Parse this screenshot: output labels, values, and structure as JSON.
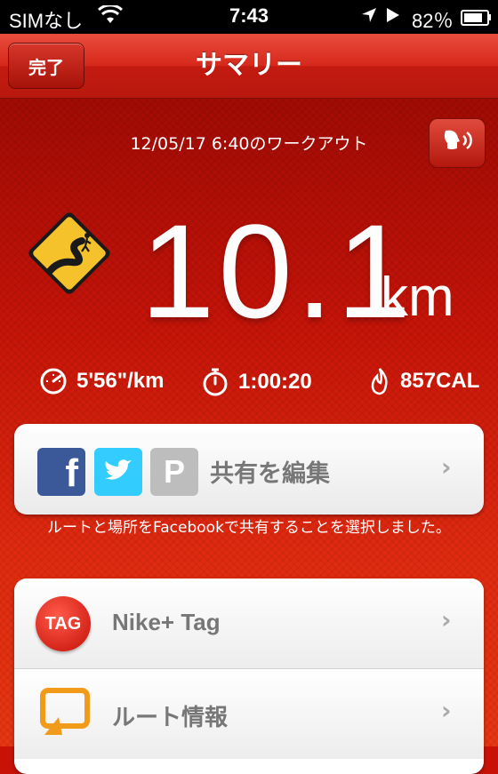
{
  "status_bar": {
    "carrier": "SIMなし",
    "time": "7:43",
    "battery_percent": "82％",
    "battery_level": 0.82
  },
  "nav": {
    "done_label": "完了",
    "title": "サマリー"
  },
  "summary": {
    "workout_date": "12/05/17 6:40のワークアウト",
    "distance_value": "10.1",
    "distance_unit": "km",
    "pace": "5'56\"/km",
    "duration": "1:00:20",
    "calories": "857CAL"
  },
  "share": {
    "label": "共有を編集",
    "note": "ルートと場所をFacebookで共有することを選択しました。"
  },
  "list": {
    "items": [
      {
        "label": "Nike+ Tag",
        "icon_text": "TAG"
      },
      {
        "label": "ルート情報"
      }
    ]
  },
  "colors": {
    "accent": "#c81208",
    "facebook": "#3b5998",
    "twitter": "#33ccff",
    "pinterest": "#bdbdbd"
  }
}
